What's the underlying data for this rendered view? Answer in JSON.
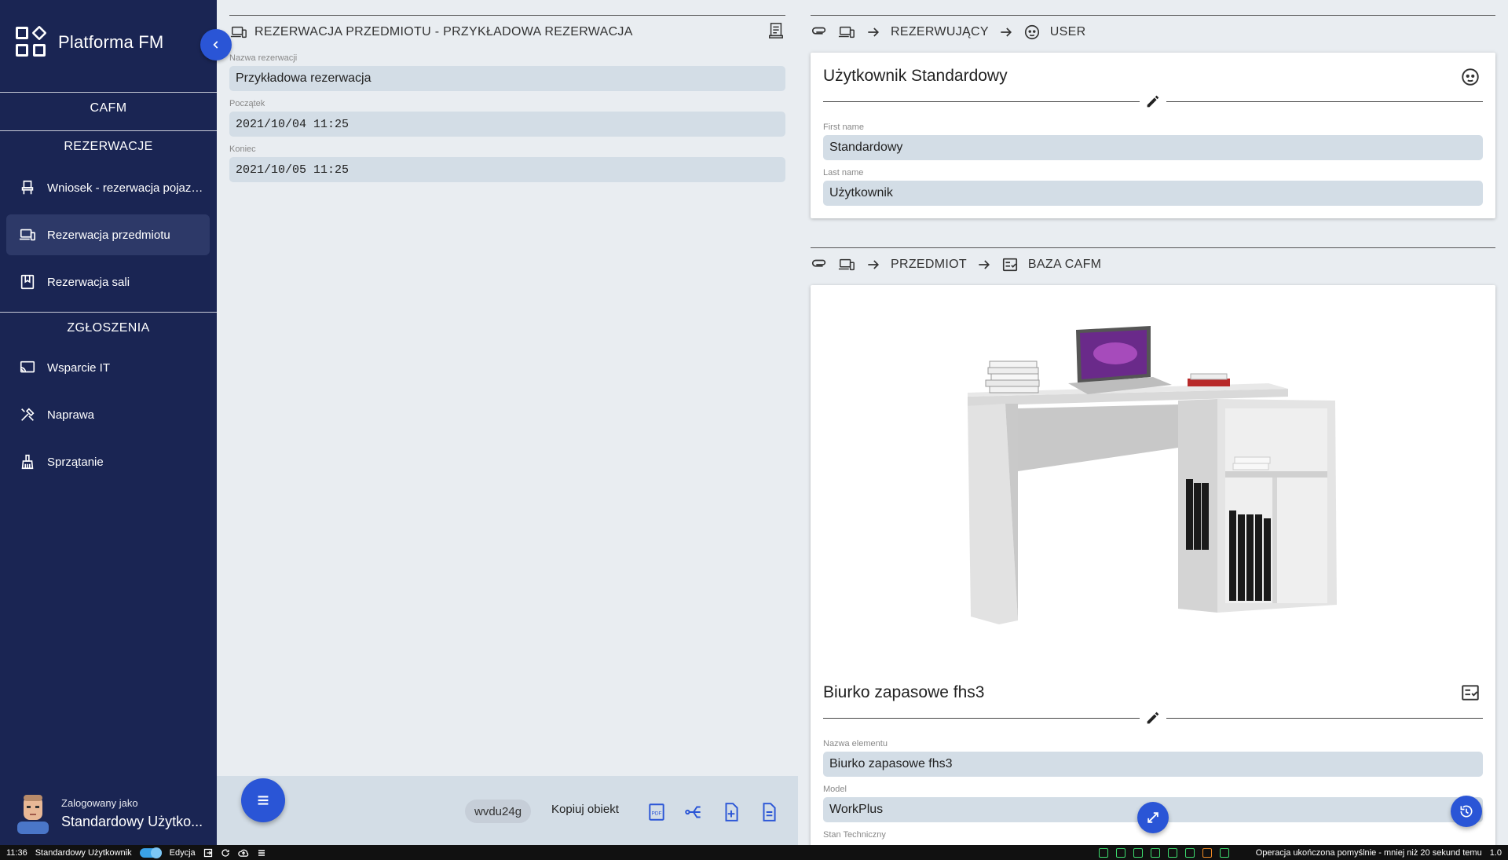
{
  "sidebar": {
    "brand": "Platforma FM",
    "cafm_label": "CAFM",
    "sections": [
      {
        "title": "REZERWACJE",
        "items": [
          {
            "label": "Wniosek - rezerwacja pojazdu",
            "icon": "seat-icon"
          },
          {
            "label": "Rezerwacja przedmiotu",
            "icon": "devices-icon",
            "active": true
          },
          {
            "label": "Rezerwacja sali",
            "icon": "bookmark-icon"
          }
        ]
      },
      {
        "title": "ZGŁOSZENIA",
        "items": [
          {
            "label": "Wsparcie IT",
            "icon": "cast-icon"
          },
          {
            "label": "Naprawa",
            "icon": "tools-icon"
          },
          {
            "label": "Sprzątanie",
            "icon": "broom-icon"
          }
        ]
      }
    ],
    "user": {
      "caption": "Zalogowany jako",
      "name": "Standardowy Użytko..."
    }
  },
  "main": {
    "header": "REZERWACJA PRZEDMIOTU - PRZYKŁADOWA REZERWACJA",
    "fields": [
      {
        "label": "Nazwa rezerwacji",
        "value": "Przykładowa rezerwacja"
      },
      {
        "label": "Początek",
        "value": "2021/10/04 11:25"
      },
      {
        "label": "Koniec",
        "value": "2021/10/05 11:25"
      }
    ],
    "footer": {
      "code": "wvdu24g",
      "copy_label": "Kopiuj obiekt",
      "pdf_label": "PDF"
    }
  },
  "right": {
    "user_path": {
      "segment1": "REZERWUJĄCY",
      "segment2": "USER"
    },
    "user_card": {
      "title": "Użytkownik Standardowy",
      "fields": [
        {
          "label": "First name",
          "value": "Standardowy"
        },
        {
          "label": "Last name",
          "value": "Użytkownik"
        }
      ]
    },
    "item_path": {
      "segment1": "PRZEDMIOT",
      "segment2": "BAZA CAFM"
    },
    "item_card": {
      "title": "Biurko zapasowe fhs3",
      "fields": [
        {
          "label": "Nazwa elementu",
          "value": "Biurko zapasowe fhs3"
        },
        {
          "label": "Model",
          "value": "WorkPlus"
        },
        {
          "label": "Stan Techniczny",
          "value": ""
        }
      ]
    }
  },
  "statusbar": {
    "time": "11:36",
    "user": "Standardowy Użytkownik",
    "mode": "Edycja",
    "message": "Operacja ukończona pomyślnie - mniej niż 20 sekund temu",
    "version": "1.0"
  },
  "colors": {
    "sidebar_bg": "#1a2553",
    "accent": "#2a55d6",
    "field_bg": "#d3dde6",
    "page_bg": "#e9edf1"
  }
}
